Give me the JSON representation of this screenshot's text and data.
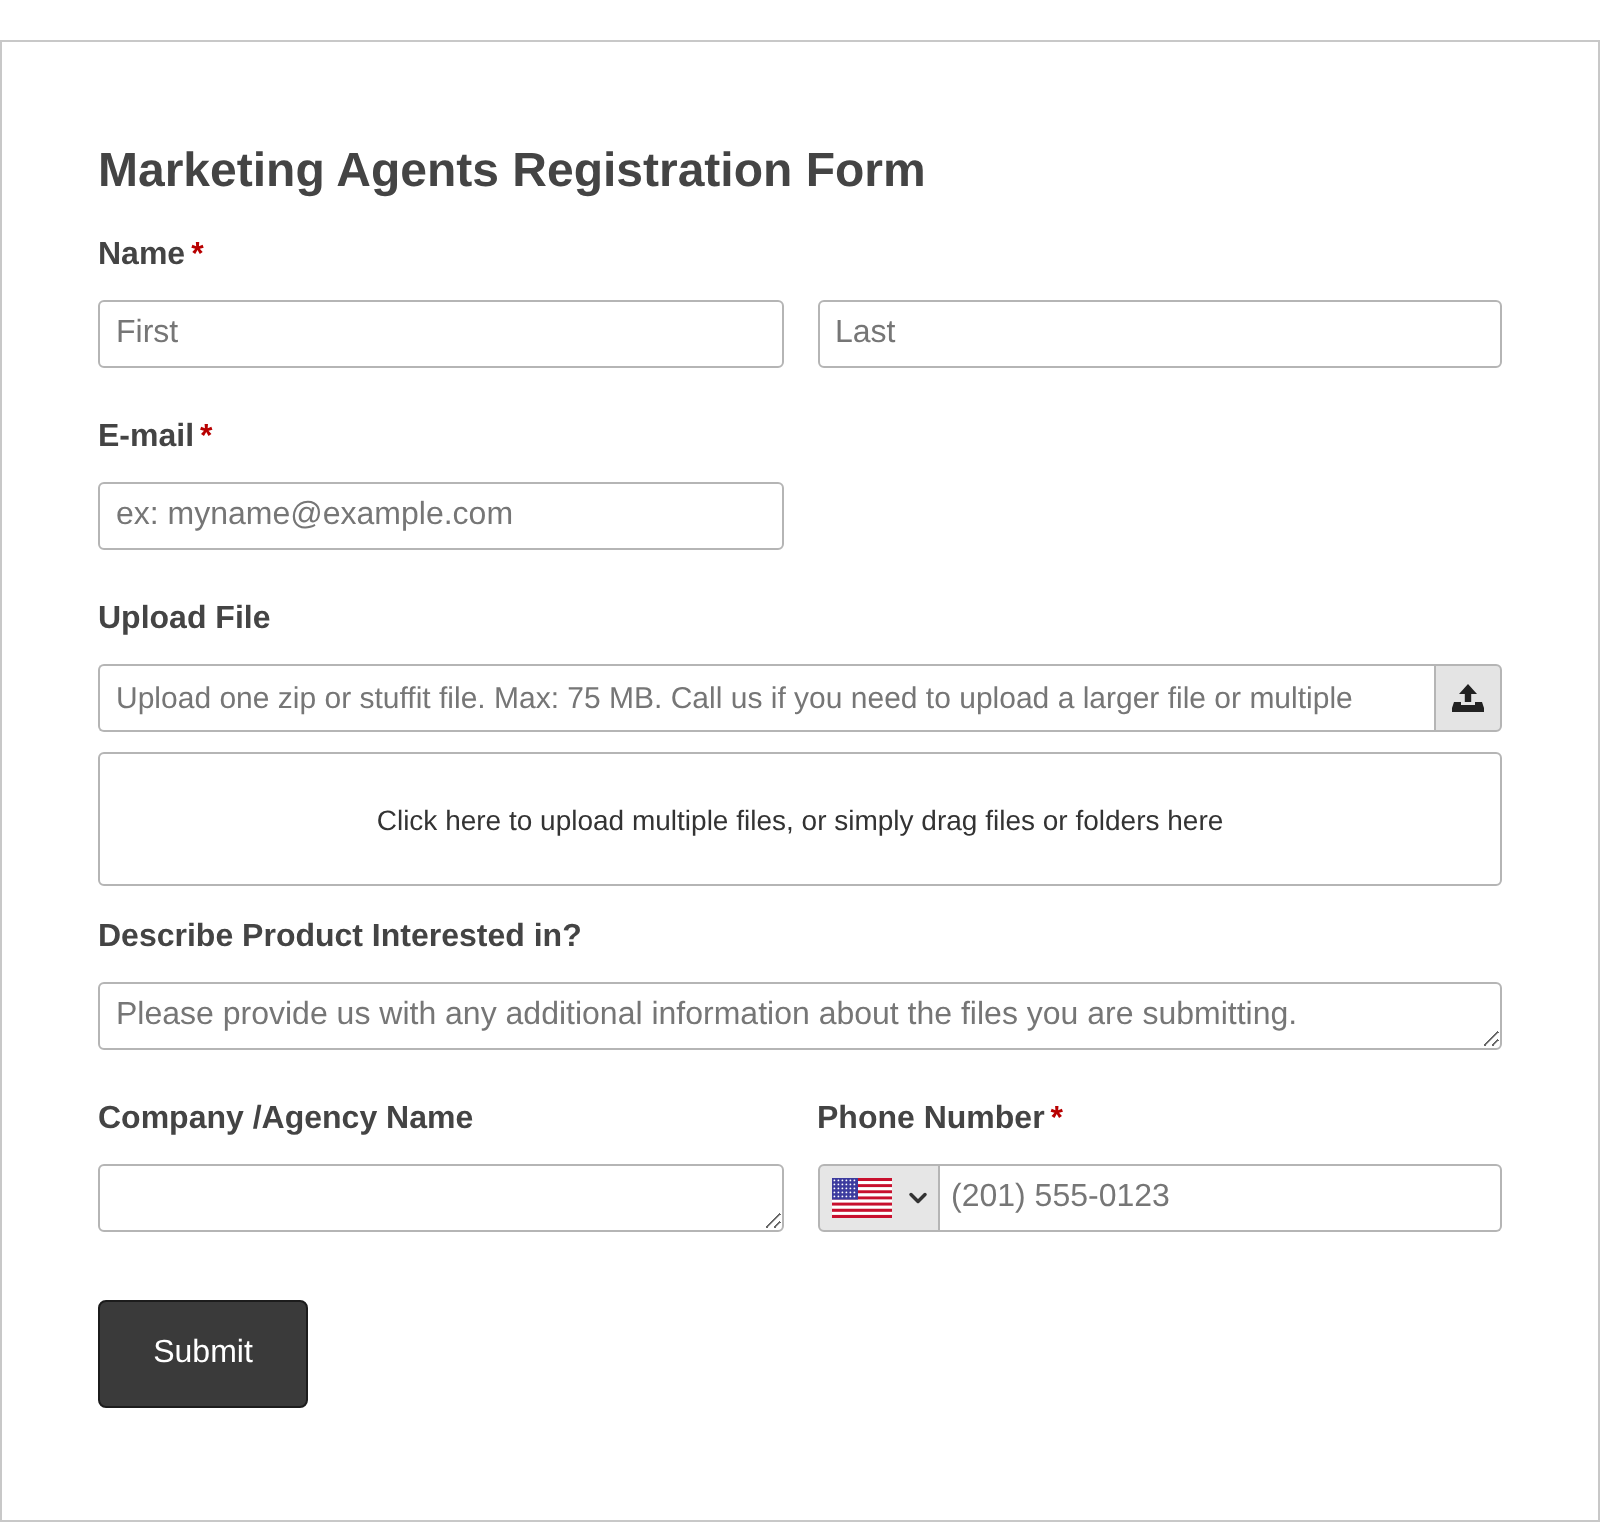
{
  "form": {
    "title": "Marketing Agents Registration Form",
    "fields": [
      {
        "kind": "name",
        "label": "Name",
        "required_mark": "*",
        "inputs": [
          {
            "placeholder": "First"
          },
          {
            "placeholder": "Last"
          }
        ]
      },
      {
        "kind": "email",
        "label": "E-mail",
        "required_mark": "*",
        "placeholder": "ex: myname@example.com"
      },
      {
        "kind": "upload",
        "label": "Upload File",
        "placeholder": "Upload one zip or stuffit file. Max: 75 MB. Call us if you need to upload a larger file or multiple",
        "dropzone": "Click here to upload multiple files, or simply drag files or folders here"
      },
      {
        "kind": "long_text",
        "label": "Describe Product Interested in?",
        "placeholder": "Please provide us with any additional information about the files you are submitting."
      },
      {
        "kind": "pair",
        "columns": [
          {
            "kind": "long_text",
            "label": "Company /Agency Name"
          },
          {
            "kind": "phone",
            "label": "Phone Number",
            "required_mark": "*",
            "placeholder": "(201) 555-0123"
          }
        ]
      }
    ],
    "submit": "Submit"
  }
}
